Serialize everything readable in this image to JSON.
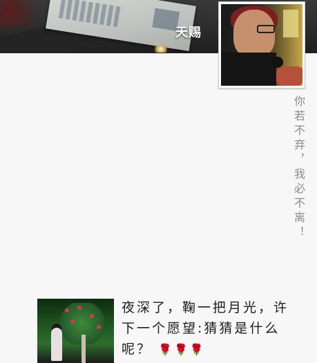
{
  "profile": {
    "username": "天赐",
    "motto": "你若不弃，我必不离！"
  },
  "post": {
    "text": "夜深了，鞠一把月光，许下一个愿望:猜猜是什么呢？",
    "emoji": "🌹🌹🌹"
  },
  "colors": {
    "background": "#f7f7f7",
    "motto_text": "#8a8a8a",
    "post_text": "#1c1c1c"
  },
  "icons": {
    "rose": "rose-emoji-icon"
  }
}
